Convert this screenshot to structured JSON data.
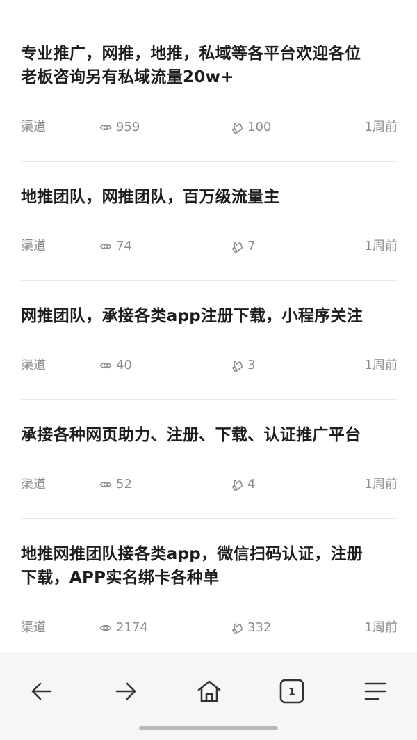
{
  "feed": {
    "items": [
      {
        "title_lines": [
          "专业推广，网推，地推，私域等各平台欢迎各位",
          "老板咨询另有私域流量20w+"
        ],
        "channel": "渠道",
        "views": "959",
        "likes": "100",
        "time": "1周前"
      },
      {
        "title_lines": [
          "地推团队，网推团队，百万级流量主"
        ],
        "channel": "渠道",
        "views": "74",
        "likes": "7",
        "time": "1周前"
      },
      {
        "title_lines": [
          "网推团队，承接各类app注册下载，小程序关注"
        ],
        "channel": "渠道",
        "views": "40",
        "likes": "3",
        "time": "1周前"
      },
      {
        "title_lines": [
          "承接各种网页助力、注册、下载、认证推广平台"
        ],
        "channel": "渠道",
        "views": "52",
        "likes": "4",
        "time": "1周前"
      },
      {
        "title_lines": [
          "地推网推团队接各类app，微信扫码认证，注册",
          "下载，APP实名绑卡各种单"
        ],
        "channel": "渠道",
        "views": "2174",
        "likes": "332",
        "time": "1周前"
      }
    ]
  },
  "icons": {
    "views": "eye-icon",
    "likes": "thumbs-up-icon"
  },
  "browser_toolbar": {
    "back_icon": "arrow-left-icon",
    "forward_icon": "arrow-right-icon",
    "home_icon": "home-icon",
    "tabs_count": "1",
    "menu_icon": "menu-icon"
  },
  "colors": {
    "title": "#1d1d1d",
    "meta": "#8c8c8c",
    "separator": "#e9e9e9",
    "toolbar_bg": "#f6f6f6"
  }
}
